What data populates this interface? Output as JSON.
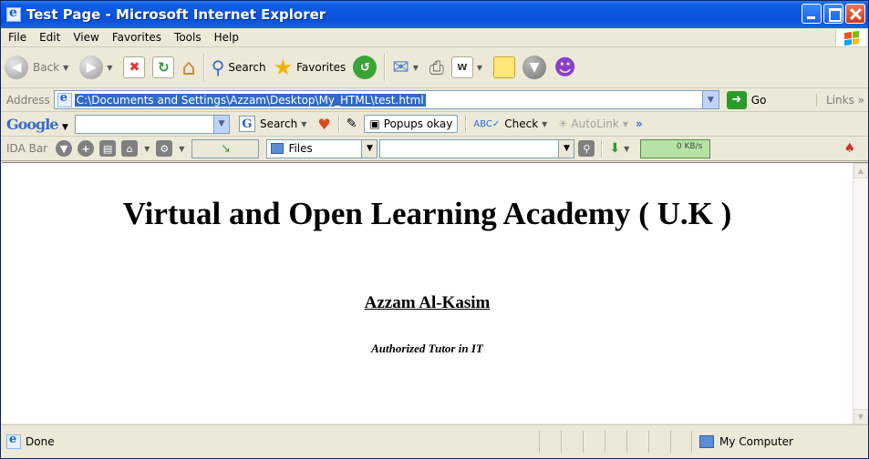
{
  "window": {
    "title": "Test Page - Microsoft Internet Explorer"
  },
  "menu": [
    "File",
    "Edit",
    "View",
    "Favorites",
    "Tools",
    "Help"
  ],
  "toolbar": {
    "back_label": "Back",
    "search_label": "Search",
    "favorites_label": "Favorites"
  },
  "address": {
    "label": "Address",
    "url": "C:\\Documents and Settings\\Azzam\\Desktop\\My_HTML\\test.html",
    "go_label": "Go",
    "links_label": "Links"
  },
  "google_bar": {
    "logo": "Google",
    "search_label": "Search",
    "popups_label": "Popups okay",
    "check_label": "Check",
    "autolink_label": "AutoLink"
  },
  "ida_bar": {
    "label": "IDA Bar",
    "files_label": "Files",
    "speed": "0 KB/s"
  },
  "page": {
    "heading": "Virtual and Open Learning Academy ( U.K )",
    "author": "Azzam Al-Kasim",
    "subtitle": "Authorized Tutor in IT"
  },
  "status": {
    "text": "Done",
    "zone": "My Computer"
  },
  "colors": {
    "titlebar": "#0a52d8",
    "selection": "#316ac5",
    "speed_meter": "#b6e3a5"
  }
}
